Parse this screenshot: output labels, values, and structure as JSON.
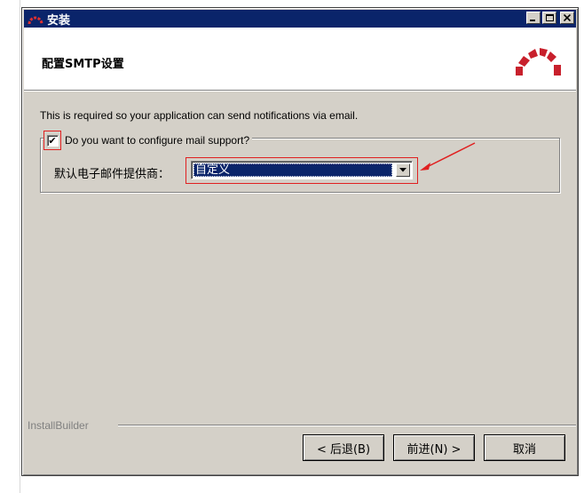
{
  "window": {
    "title": "安装",
    "title_icon": "bitnami-arc-icon",
    "controls": [
      "minimize",
      "maximize",
      "close"
    ]
  },
  "header": {
    "title": "配置SMTP设置",
    "logo": "bitnami-logo-icon",
    "logo_color": "#c8202c"
  },
  "content": {
    "description": "This is required so your application can send notifications via email.",
    "mail_support": {
      "label": "Do you want to configure mail support?",
      "checked": true,
      "check_glyph": "✔"
    },
    "provider": {
      "label": "默认电子邮件提供商：",
      "selected": "自定义"
    }
  },
  "footer": {
    "brand": "InstallBuilder",
    "back_label": "< 后退(B)",
    "next_label": "前进(N) >",
    "cancel_label": "取消"
  },
  "colors": {
    "titlebar": "#0a246a",
    "window_bg": "#d4d0c8",
    "annotation": "#e02020",
    "selection": "#0a246a"
  }
}
